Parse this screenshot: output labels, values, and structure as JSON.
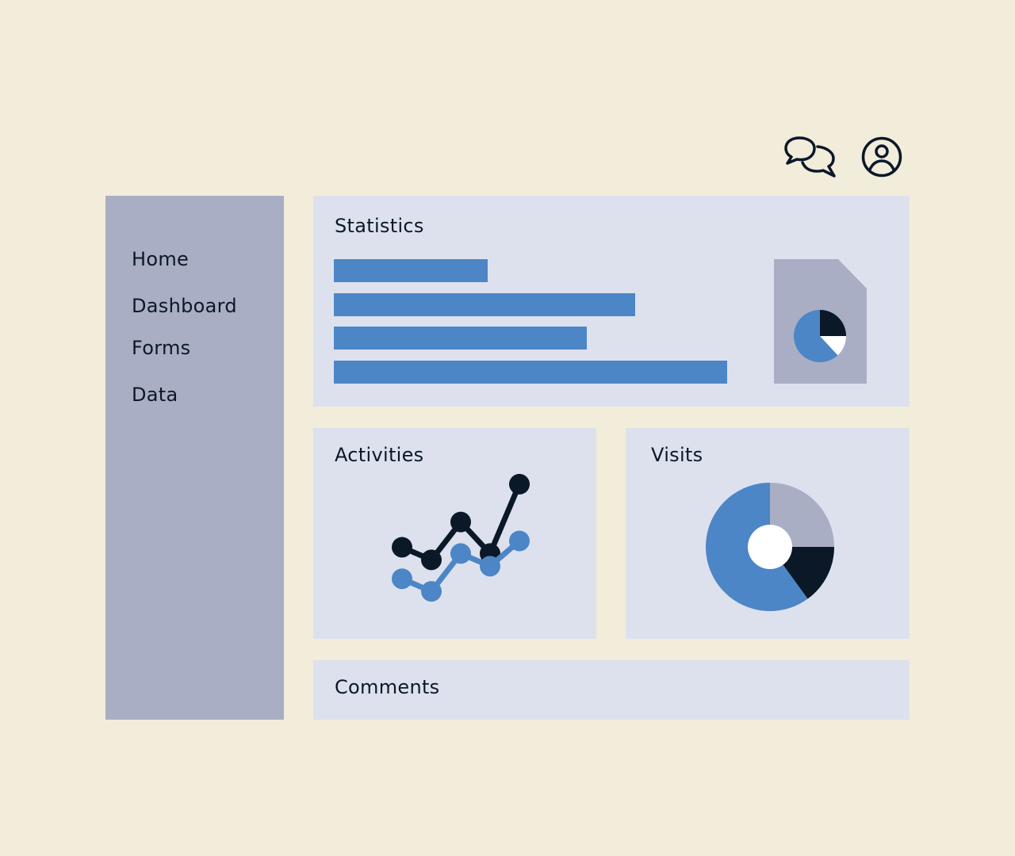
{
  "header": {
    "icons": [
      "chat-bubbles-icon",
      "user-avatar-icon"
    ]
  },
  "sidebar": {
    "items": [
      {
        "label": "Home"
      },
      {
        "label": "Dashboard"
      },
      {
        "label": "Forms"
      },
      {
        "label": "Data"
      }
    ]
  },
  "colors": {
    "background": "#F2ECDB",
    "sidebar": "#A9AEC4",
    "panel": "#DDE1EE",
    "accent_blue": "#4C86C6",
    "dark": "#0B1828",
    "gray": "#A9AEC4",
    "white": "#FFFFFF"
  },
  "statistics": {
    "title": "Statistics",
    "chart_data": {
      "type": "bar",
      "orientation": "horizontal",
      "values": [
        194,
        380,
        319,
        496
      ],
      "xlim": [
        0,
        496
      ]
    },
    "file_icon": "pie-chart-file-icon"
  },
  "activities": {
    "title": "Activities",
    "chart_data": {
      "type": "line",
      "x": [
        1,
        2,
        3,
        4,
        5
      ],
      "series": [
        {
          "color": "#0B1828",
          "values": [
            10,
            8,
            14,
            9,
            20
          ]
        },
        {
          "color": "#4C86C6",
          "values": [
            5,
            3,
            9,
            7,
            11
          ]
        }
      ],
      "ylim": [
        0,
        22
      ]
    }
  },
  "visits": {
    "title": "Visits",
    "chart_data": {
      "type": "pie",
      "style": "donut",
      "slices": [
        {
          "value": 25,
          "color": "#A9AEC4"
        },
        {
          "value": 15,
          "color": "#0B1828"
        },
        {
          "value": 60,
          "color": "#4C86C6"
        }
      ]
    }
  },
  "comments": {
    "title": "Comments"
  }
}
